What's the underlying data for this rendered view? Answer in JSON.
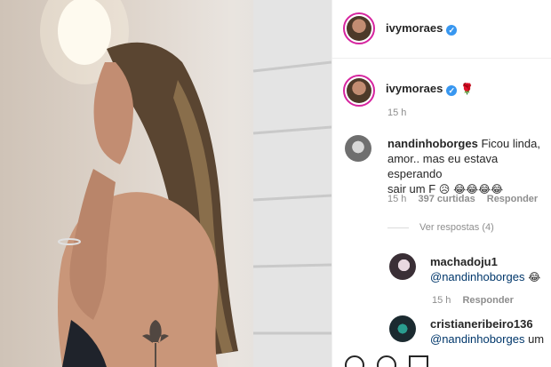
{
  "post": {
    "author": "ivymoraes",
    "caption_emoji": "🌹",
    "caption_time": "15 h"
  },
  "comments": [
    {
      "username": "nandinhoborges",
      "text_line1": " Ficou linda,",
      "text_line2": "amor.. mas eu estava esperando",
      "text_line3": "sair um F ",
      "emojis": "😥 😂😂😂😂",
      "time": "15 h",
      "likes": "397 curtidas",
      "reply": "Responder",
      "view_replies": "Ver respostas (4)"
    }
  ],
  "replies": [
    {
      "username": "machadoju1",
      "mention": "@nandinhoborges",
      "after": " 😂",
      "time": "15 h",
      "reply": "Responder"
    },
    {
      "username": "cristianeribeiro136",
      "mention": "@nandinhoborges",
      "after": " um"
    }
  ],
  "colors": {
    "verified": "#3897f0",
    "mention": "#00376b",
    "meta": "#8e8e8e",
    "avatar_ring": "#d6249f"
  }
}
